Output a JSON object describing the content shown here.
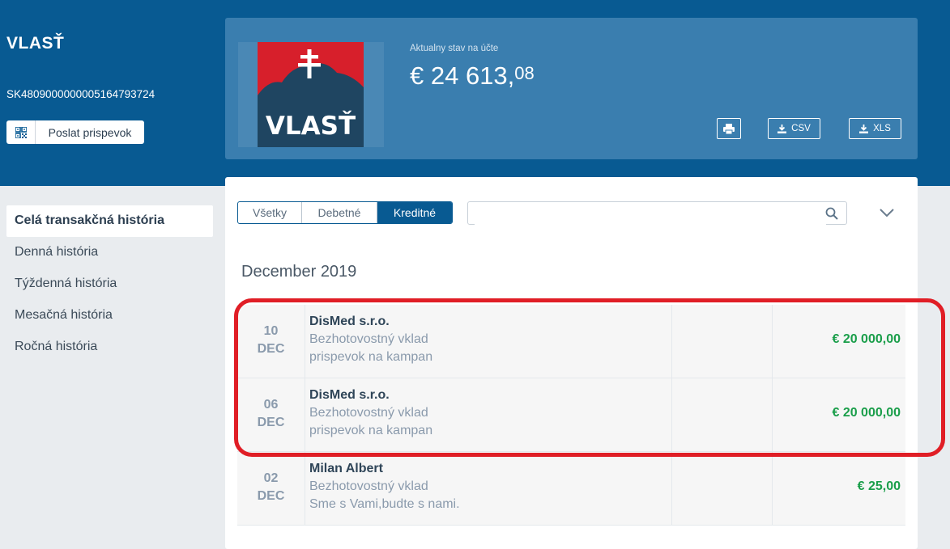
{
  "account": {
    "name": "VLASŤ",
    "iban": "SK4809000000005164793724",
    "send_button_label": "Poslat prispevok"
  },
  "hero": {
    "logo_text": "VLASŤ",
    "balance_label": "Aktualny stav na účte",
    "balance_main": "€ 24 613,",
    "balance_cents": "08",
    "export_csv": "CSV",
    "export_xls": "XLS"
  },
  "sidebar": {
    "items": [
      {
        "label": "Celá transakčná história",
        "active": true
      },
      {
        "label": "Denná história"
      },
      {
        "label": "Týždenná história"
      },
      {
        "label": "Mesačná história"
      },
      {
        "label": "Ročná história"
      }
    ]
  },
  "filters": {
    "tabs": [
      "Všetky",
      "Debetné",
      "Kreditné"
    ],
    "selected": "Kreditné",
    "search_value": ""
  },
  "month_heading": "December 2019",
  "transactions": [
    {
      "day": "10",
      "month": "DEC",
      "name": "DisMed s.r.o.",
      "type": "Bezhotovostný vklad",
      "note": "prispevok na kampan",
      "amount": "€ 20 000,00"
    },
    {
      "day": "06",
      "month": "DEC",
      "name": "DisMed s.r.o.",
      "type": "Bezhotovostný vklad",
      "note": "prispevok na kampan",
      "amount": "€ 20 000,00"
    },
    {
      "day": "02",
      "month": "DEC",
      "name": "Milan Albert",
      "type": "Bezhotovostný vklad",
      "note": "Sme s Vami,budte s nami.",
      "amount": "€ 25,00"
    }
  ],
  "colors": {
    "header_blue": "#085a92",
    "hero_blue": "#3a7eaf",
    "credit_green": "#1a9e4a",
    "highlight_red": "#e01e26",
    "logo_red": "#d71f2b",
    "logo_navy": "#1f4561"
  },
  "icons": {
    "send": "qr-code-icon",
    "print": "printer-icon",
    "csv": "download-icon",
    "xls": "download-icon",
    "search": "search-icon",
    "expand": "chevron-down-icon"
  }
}
